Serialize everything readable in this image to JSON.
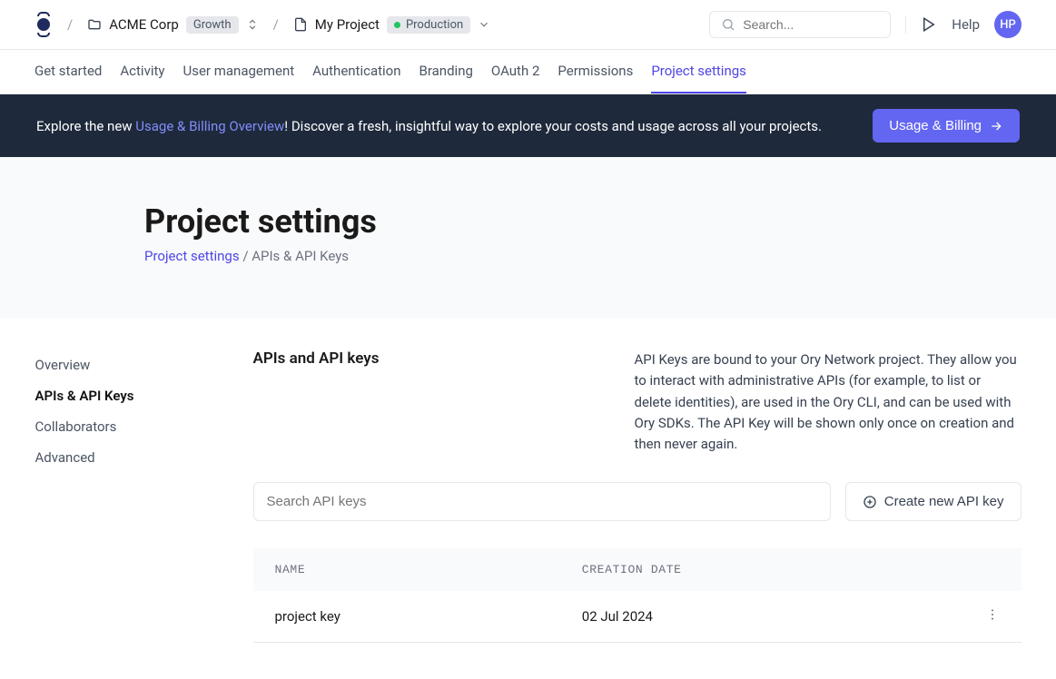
{
  "header": {
    "workspace": {
      "name": "ACME Corp",
      "plan": "Growth"
    },
    "project": {
      "name": "My Project",
      "env": "Production"
    },
    "search_placeholder": "Search...",
    "help": "Help",
    "avatar_initials": "HP"
  },
  "tabs": [
    {
      "label": "Get started"
    },
    {
      "label": "Activity"
    },
    {
      "label": "User management"
    },
    {
      "label": "Authentication"
    },
    {
      "label": "Branding"
    },
    {
      "label": "OAuth 2"
    },
    {
      "label": "Permissions"
    },
    {
      "label": "Project settings"
    }
  ],
  "banner": {
    "prefix": "Explore the new ",
    "link_text": "Usage & Billing Overview",
    "suffix": "! Discover a fresh, insightful way to explore your costs and usage across all your projects.",
    "button": "Usage & Billing"
  },
  "page": {
    "title": "Project settings",
    "breadcrumb_root": "Project settings",
    "breadcrumb_sep": " / ",
    "breadcrumb_current": "APIs & API Keys"
  },
  "sidebar": {
    "items": [
      {
        "label": "Overview"
      },
      {
        "label": "APIs & API Keys"
      },
      {
        "label": "Collaborators"
      },
      {
        "label": "Advanced"
      }
    ]
  },
  "section": {
    "title": "APIs and API keys",
    "description": "API Keys are bound to your Ory Network project. They allow you to interact with administrative APIs (for example, to list or delete identities), are used in the Ory CLI, and can be used with Ory SDKs. The API Key will be shown only once on creation and then never again."
  },
  "controls": {
    "search_placeholder": "Search API keys",
    "create_label": "Create new API key"
  },
  "table": {
    "col_name": "NAME",
    "col_date": "CREATION DATE",
    "rows": [
      {
        "name": "project key",
        "date": "02 Jul 2024"
      }
    ]
  }
}
